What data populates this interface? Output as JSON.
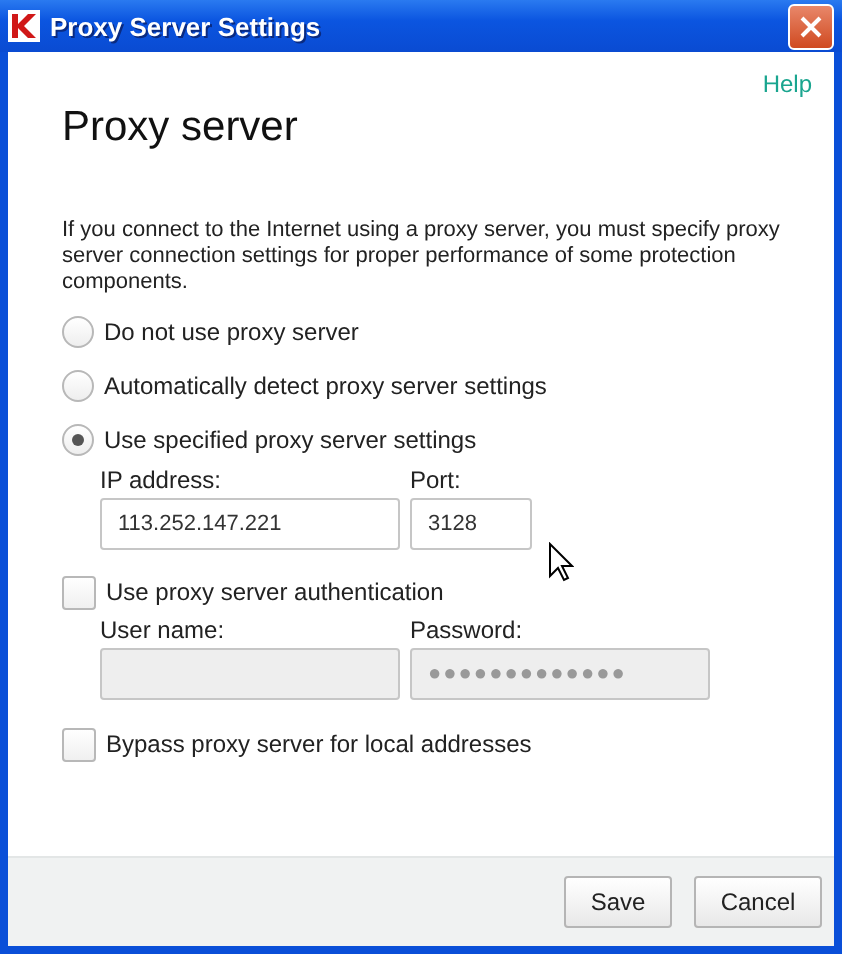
{
  "window": {
    "title": "Proxy Server Settings"
  },
  "help_link": "Help",
  "heading": "Proxy server",
  "description": "If you connect to the Internet using a proxy server, you must specify proxy server connection settings for proper performance of some protection components.",
  "proxy_options": [
    {
      "label": "Do not use proxy server",
      "selected": false
    },
    {
      "label": "Automatically detect proxy server settings",
      "selected": false
    },
    {
      "label": "Use specified proxy server settings",
      "selected": true
    }
  ],
  "address_fields": [
    {
      "label": "IP address:",
      "value": "113.252.147.221",
      "disabled": false,
      "kind": "wide"
    },
    {
      "label": "Port:",
      "value": "3128",
      "disabled": false,
      "kind": "narrow"
    }
  ],
  "auth_checkbox": {
    "label": "Use proxy server authentication",
    "checked": false
  },
  "auth_fields": [
    {
      "label": "User name:",
      "disabled": true,
      "kind": "wide"
    },
    {
      "label": "Password:",
      "value": "●●●●●●●●●●●●●",
      "disabled": true,
      "kind": "wide"
    }
  ],
  "bypass_checkbox": {
    "label": "Bypass proxy server for local addresses",
    "checked": false
  },
  "buttons": [
    "Save",
    "Cancel"
  ]
}
